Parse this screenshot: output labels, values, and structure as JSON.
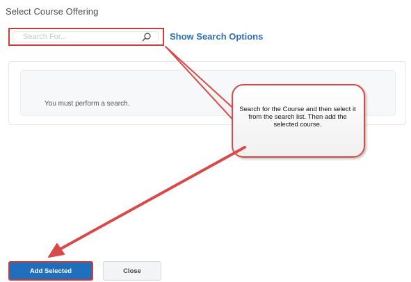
{
  "dialog": {
    "title": "Select Course Offering"
  },
  "search": {
    "placeholder": "Search For...",
    "icon": "search-icon",
    "show_options_label": "Show Search Options"
  },
  "results": {
    "empty_message": "You must perform a search."
  },
  "annotation": {
    "callout_text": "Search for the Course and then select it from the search list. Then add the selected course.",
    "colors": {
      "highlight": "#d03a3a",
      "arrow": "#d84a4a"
    }
  },
  "buttons": {
    "add_selected_label": "Add Selected",
    "close_label": "Close"
  },
  "colors": {
    "primary": "#1f6fbd",
    "link": "#2e6fb3"
  }
}
